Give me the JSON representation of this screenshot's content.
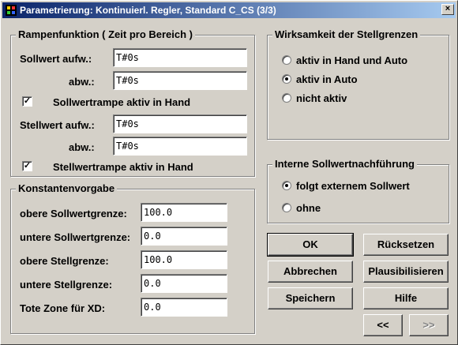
{
  "window": {
    "title": "Parametrierung: Kontinuierl. Regler, Standard  C_CS  (3/3)",
    "close_glyph": "×"
  },
  "rampen": {
    "title": "Rampenfunktion ( Zeit pro Bereich )",
    "sollwert_label": "Sollwert  aufw.:",
    "sollwert_aufw": "T#0s",
    "abw_label": "abw.:",
    "sollwert_abw": "T#0s",
    "sollwertrampe_label": "Sollwertrampe aktiv in Hand",
    "sollwertrampe_checked": true,
    "stellwert_label": "Stellwert  aufw.:",
    "stellwert_aufw": "T#0s",
    "stellwert_abw_label": "abw.:",
    "stellwert_abw": "T#0s",
    "stellwertrampe_label": "Stellwertrampe aktiv in Hand",
    "stellwertrampe_checked": true,
    "check_glyph": "✓"
  },
  "konstanten": {
    "title": "Konstantenvorgabe",
    "rows": [
      {
        "label": "obere Sollwertgrenze:",
        "value": "100.0"
      },
      {
        "label": "untere Sollwertgrenze:",
        "value": "0.0"
      },
      {
        "label": "obere Stellgrenze:",
        "value": "100.0"
      },
      {
        "label": "untere Stellgrenze:",
        "value": "0.0"
      },
      {
        "label": "Tote Zone für XD:",
        "value": "0.0"
      }
    ]
  },
  "wirksamkeit": {
    "title": "Wirksamkeit der Stellgrenzen",
    "options": [
      "aktiv in Hand und Auto",
      "aktiv in Auto",
      "nicht aktiv"
    ],
    "selected": "aktiv in Auto"
  },
  "nachfuehrung": {
    "title": "Interne Sollwertnachführung",
    "options": [
      "folgt externem Sollwert",
      "ohne"
    ],
    "selected": "folgt externem Sollwert"
  },
  "buttons": {
    "ok": "OK",
    "ruecksetzen": "Rücksetzen",
    "abbrechen": "Abbrechen",
    "plausibilisieren": "Plausibilisieren",
    "speichern": "Speichern",
    "hilfe": "Hilfe",
    "back": "<<",
    "forward": ">>"
  }
}
